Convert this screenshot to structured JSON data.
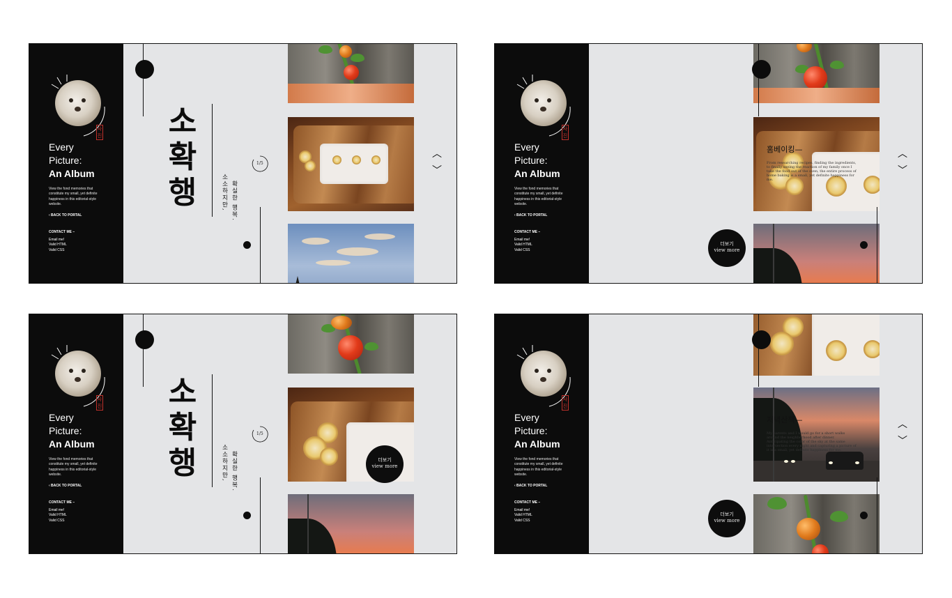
{
  "sidebar": {
    "brand_l1": "Every",
    "brand_l2": "Picture:",
    "brand_l3": "An Album",
    "description": "View the fond memories that constitute my small, yet definite happiness in this editorial-style website.",
    "back_label": "‹ BACK TO PORTAL",
    "contact_heading": "CONTACT ME –",
    "contact_items": [
      "Email me!",
      "Valid HTML",
      "Valid CSS"
    ],
    "stamp": "사진"
  },
  "hero": {
    "title": "소확행",
    "vertical_col1": "소소하지만,",
    "vertical_col2": "확실한 행복.",
    "counter": "1/5"
  },
  "detail": {
    "baking_title": "홈베이킹—",
    "baking_desc": "From researching recipes, finding the ingredients, to finally seeing the reaction of my family once I take the food out of the oven, the entire process of home baking is a small, yet definite happiness for me.",
    "walk_title": "저녁산책—",
    "walk_desc": "My parents and I would go for a short walks around the neighborhood after dinner. Anticipating the color of the sky at the same intersection every night and capturing a picture of it is a small, yet definite happiness for me."
  },
  "view_more": {
    "korean": "더보기",
    "english": "view more"
  },
  "icons": {
    "up": "chevron-up-icon",
    "down": "chevron-down-icon"
  },
  "colors": {
    "sidebar": "#0c0c0c",
    "background": "#e4e5e7",
    "accent_stamp": "#c0312b"
  }
}
